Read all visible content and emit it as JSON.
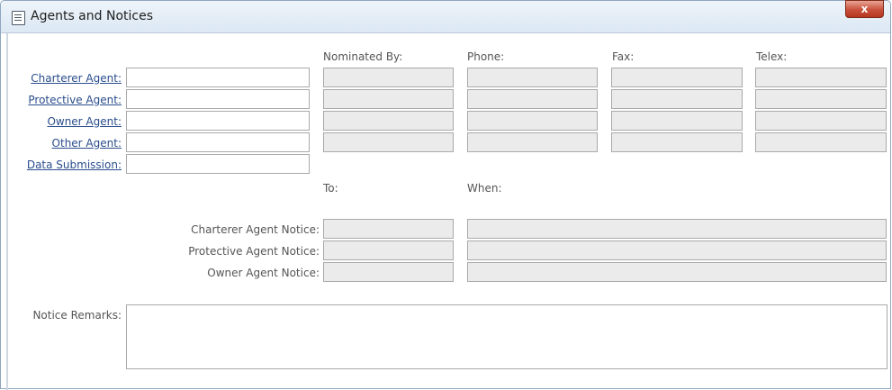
{
  "window": {
    "title": "Agents and Notices",
    "close_label": "x"
  },
  "columns": {
    "nominated_by": "Nominated By:",
    "phone": "Phone:",
    "fax": "Fax:",
    "telex": "Telex:"
  },
  "agents": [
    {
      "label": "Charterer Agent:",
      "value": ""
    },
    {
      "label": "Protective Agent:",
      "value": ""
    },
    {
      "label": "Owner Agent:",
      "value": ""
    },
    {
      "label": "Other Agent:",
      "value": ""
    },
    {
      "label": "Data Submission:",
      "value": ""
    }
  ],
  "notices_header": {
    "to": "To:",
    "when": "When:"
  },
  "notices": [
    {
      "label": "Charterer Agent Notice:",
      "to": "",
      "when": ""
    },
    {
      "label": "Protective Agent Notice:",
      "to": "",
      "when": ""
    },
    {
      "label": "Owner Agent Notice:",
      "to": "",
      "when": ""
    }
  ],
  "remarks": {
    "label": "Notice Remarks:",
    "value": ""
  }
}
